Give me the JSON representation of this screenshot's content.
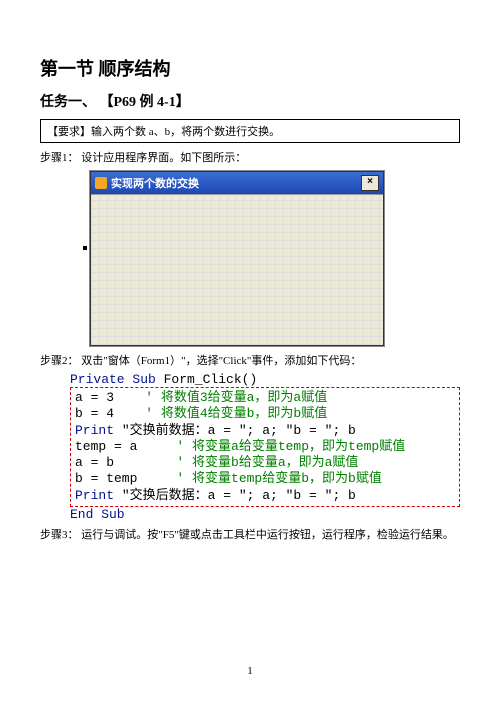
{
  "heading1": "第一节 顺序结构",
  "heading2": "任务一、  【P69 例 4-1】",
  "requirement": "【要求】输入两个数 a、b，将两个数进行交换。",
  "step1": "步骤1：  设计应用程序界面。如下图所示：",
  "window": {
    "title": "实现两个数的交换",
    "close": "×"
  },
  "step2": "步骤2：  双击\"窗体（Form1）\"，选择\"Click\"事件，添加如下代码：",
  "code": {
    "head_kw1": "Private Sub",
    "head_name": " Form_Click()",
    "l1_a": "a = 3    ",
    "l1_b": "' 将数值3给变量a，即为a赋值",
    "l2_a": "b = 4    ",
    "l2_b": "' 将数值4给变量b，即为b赋值",
    "l3_a": "Print",
    "l3_b": " \"交换前数据：a = \"; a; \"b = \"; b",
    "l4_a": "temp = a     ",
    "l4_b": "' 将变量a给变量temp，即为temp赋值",
    "l5_a": "a = b        ",
    "l5_b": "' 将变量b给变量a，即为a赋值",
    "l6_a": "b = temp     ",
    "l6_b": "' 将变量temp给变量b，即为b赋值",
    "l7_a": "Print",
    "l7_b": " \"交换后数据：a = \"; a; \"b = \"; b",
    "end": "End Sub"
  },
  "step3": "步骤3：  运行与调试。按\"F5\"键或点击工具栏中运行按钮，运行程序，检验运行结果。",
  "pageNumber": "1"
}
